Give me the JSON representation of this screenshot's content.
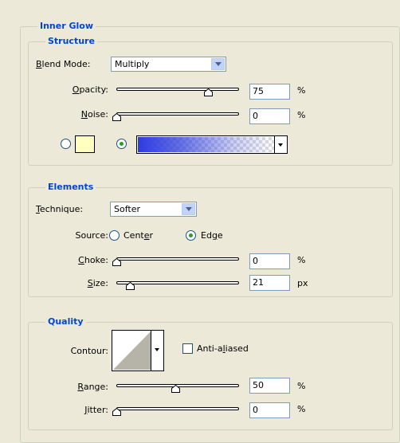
{
  "panel": {
    "title": "Inner Glow",
    "structure": {
      "title": "Structure",
      "blend_mode": {
        "label": "Blend Mode:",
        "value": "Multiply"
      },
      "opacity": {
        "label": "Opacity:",
        "value": "75",
        "unit": "%",
        "level": 0.75
      },
      "noise": {
        "label": "Noise:",
        "value": "0",
        "unit": "%",
        "level": 0
      },
      "glow_color": "#FFFFC0",
      "gradient_start": "#2E3CE0"
    },
    "elements": {
      "title": "Elements",
      "technique": {
        "label": "Technique:",
        "value": "Softer"
      },
      "source": {
        "label": "Source:",
        "center": "Center",
        "edge": "Edge",
        "selected": "Edge"
      },
      "choke": {
        "label": "Choke:",
        "value": "0",
        "unit": "%",
        "level": 0
      },
      "size": {
        "label": "Size:",
        "value": "21",
        "unit": "px",
        "level": 0.08
      }
    },
    "quality": {
      "title": "Quality",
      "contour": {
        "label": "Contour:"
      },
      "anti_aliased": {
        "label": "Anti-aliased",
        "checked": false
      },
      "range": {
        "label": "Range:",
        "value": "50",
        "unit": "%",
        "level": 0.5
      },
      "jitter": {
        "label": "Jitter:",
        "value": "0",
        "unit": "%",
        "level": 0
      }
    }
  }
}
